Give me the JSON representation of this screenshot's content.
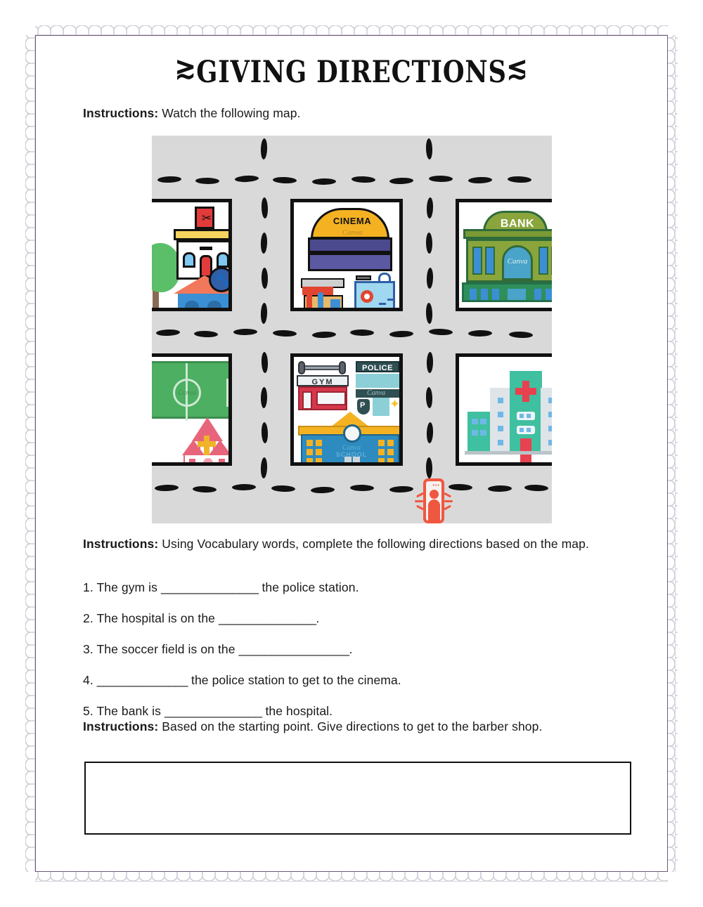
{
  "page": {
    "title": "GIVING DIRECTIONS",
    "title_deco_left": "≳",
    "title_deco_right": "≲",
    "border_color": "#6b5b7b"
  },
  "sections": {
    "instruction_1": {
      "label": "Instructions:",
      "text": " Watch the following map."
    },
    "instruction_2": {
      "label": "Instructions:",
      "text": " Using Vocabulary words, complete the following directions based on the map."
    },
    "instruction_3": {
      "label": "Instructions:",
      "text": " Based on the starting point. Give directions to get to the barber shop."
    }
  },
  "questions": [
    {
      "number": "1.",
      "before": " The gym is ",
      "blank": "_______________",
      "after": " the police station."
    },
    {
      "number": "2.",
      "before": " The hospital is on the ",
      "blank": "_______________",
      "after": "."
    },
    {
      "number": "3.",
      "before": " The soccer field is on the ",
      "blank": "_________________",
      "after": "."
    },
    {
      "number": "4.",
      "before": " ",
      "blank": "______________",
      "after": " the police station to get to the cinema."
    },
    {
      "number": "5.",
      "before": " The bank is ",
      "blank": "_______________",
      "after": " the hospital."
    }
  ],
  "answer_box": {
    "value": "",
    "placeholder": ""
  },
  "map": {
    "road_color": "#d9d9d9",
    "lane_color": "#111111",
    "blocks": [
      {
        "id": "barber-block",
        "row": "top",
        "col": "left",
        "places": [
          "barber shop",
          "pet shop",
          "tree"
        ]
      },
      {
        "id": "cinema-block",
        "row": "top",
        "col": "center",
        "places": [
          "cinema",
          "shop",
          "swimming pool"
        ]
      },
      {
        "id": "bank-block",
        "row": "top",
        "col": "right",
        "places": [
          "bank"
        ]
      },
      {
        "id": "soccer-block",
        "row": "bottom",
        "col": "left",
        "places": [
          "soccer field",
          "church"
        ]
      },
      {
        "id": "gym-block",
        "row": "bottom",
        "col": "center",
        "places": [
          "gym",
          "police station",
          "school"
        ]
      },
      {
        "id": "hospital-block",
        "row": "bottom",
        "col": "right",
        "places": [
          "hospital"
        ]
      }
    ],
    "signs": {
      "cinema": "CINEMA",
      "bank": "BANK",
      "gym": "GYM",
      "police": "POLICE",
      "school": "SCHOOL",
      "watermark": "Canva"
    },
    "start_marker": {
      "label": "starting point",
      "color": "#ef5740"
    },
    "colors": {
      "bank_green": "#7a9a35",
      "bank_dark_green": "#2f8f5b",
      "cinema_yellow": "#f4b223",
      "cinema_purple": "#4b4a8f",
      "gym_red": "#d6374b",
      "police_teal": "#2f4f52",
      "school_blue": "#2e8bc0",
      "school_roof": "#f4b223",
      "hospital_teal": "#3fc0a0",
      "hospital_cross": "#e8414f",
      "field_green": "#4caf62",
      "church_pink": "#e8647a",
      "barber_red": "#e23b3b",
      "pet_blue": "#3b8fd4",
      "tree_green": "#5bbf6a"
    }
  }
}
